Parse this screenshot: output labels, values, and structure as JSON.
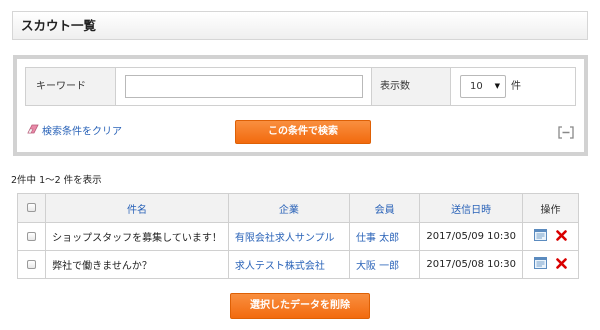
{
  "page": {
    "title": "スカウト一覧"
  },
  "search": {
    "keyword_label": "キーワード",
    "keyword_value": "",
    "count_label": "表示数",
    "count_selected": "10",
    "count_suffix": "件",
    "clear_label": "検索条件をクリア",
    "submit_label": "この条件で検索",
    "accent_color": "#f47c20",
    "link_color": "#2a63b8"
  },
  "results": {
    "summary": "2件中 1～2 件を表示",
    "columns": {
      "subject": "件名",
      "company": "企業",
      "member": "会員",
      "sent_at": "送信日時",
      "operation": "操作"
    },
    "rows": [
      {
        "subject": "ショップスタッフを募集しています！",
        "company": "有限会社求人サンプル",
        "member": "仕事 太郎",
        "sent_at": "2017/05/09 10:30"
      },
      {
        "subject": "弊社で働きませんか？",
        "company": "求人テスト株式会社",
        "member": "大阪 一郎",
        "sent_at": "2017/05/08 10:30"
      }
    ],
    "icons": {
      "view": "view-icon",
      "delete": "delete-icon"
    }
  },
  "actions": {
    "delete_selected_label": "選択したデータを削除"
  }
}
